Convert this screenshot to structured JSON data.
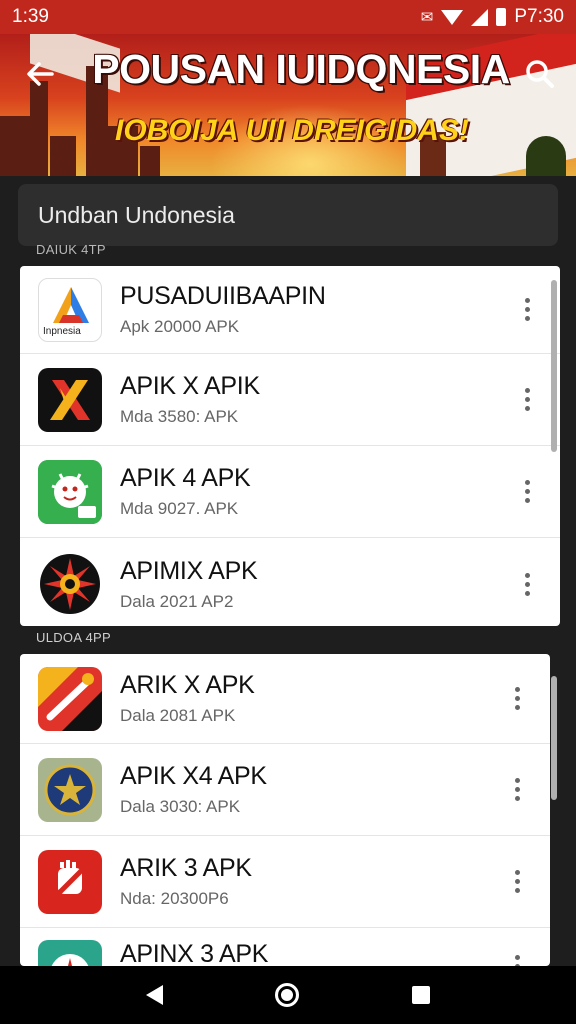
{
  "status_bar": {
    "time": "1:39",
    "clock": "P7:30",
    "icons": [
      "notification-icon",
      "wifi-icon",
      "signal-icon",
      "battery-icon"
    ]
  },
  "header": {
    "title": "POUSAN IUIDQNESIA",
    "subtitle": "IOBOIJA UII DREIGIDAS!",
    "back_icon": "arrow-left-icon",
    "search_icon": "search-icon"
  },
  "search": {
    "value": "Undban Undonesia"
  },
  "sections": [
    {
      "label": "DAIUK 4TP",
      "apps": [
        {
          "name": "PUSADUIIBAAPIN",
          "meta": "Apk 20000 APK",
          "icon": "app-icon-a",
          "icon_text": "Inpnesia"
        },
        {
          "name": "APIK X APIK",
          "meta": "Mda 3580: APK",
          "icon": "app-icon-x"
        },
        {
          "name": "APIK 4 APK",
          "meta": "Mda 9027. APK",
          "icon": "app-icon-mascot"
        },
        {
          "name": "APIMIX APK",
          "meta": "Dala 2021 AP2",
          "icon": "app-icon-sunburst"
        }
      ]
    },
    {
      "label": "ULDOA 4PP",
      "apps": [
        {
          "name": "ARIK X APK",
          "meta": "Dala 2081 APK",
          "icon": "app-icon-arrow"
        },
        {
          "name": "APIK X4 APK",
          "meta": "Dala 3030: APK",
          "icon": "app-icon-emblem"
        },
        {
          "name": "ARIK 3 APK",
          "meta": "Nda: 20300P6",
          "icon": "app-icon-fist"
        },
        {
          "name": "APINX 3 APK",
          "meta": "",
          "icon": "app-icon-compass"
        }
      ]
    }
  ],
  "nav_bar": {
    "back_icon": "nav-back-icon",
    "home_icon": "nav-home-icon",
    "recents_icon": "nav-recents-icon"
  },
  "colors": {
    "brand_red": "#c0281d",
    "accent_yellow": "#ffd21a",
    "background": "#1e1e1e"
  }
}
